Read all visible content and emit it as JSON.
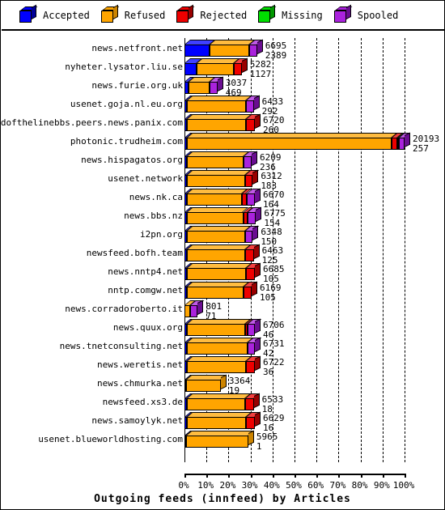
{
  "title": "Outgoing feeds (innfeed) by Articles",
  "legend": {
    "items": [
      {
        "label": "Accepted",
        "color": "#0000ff",
        "dark": "#000099",
        "icon": "cube-icon"
      },
      {
        "label": "Refused",
        "color": "#ffa500",
        "dark": "#cc8400",
        "icon": "cube-icon"
      },
      {
        "label": "Rejected",
        "color": "#ee0000",
        "dark": "#990000",
        "icon": "cube-icon"
      },
      {
        "label": "Missing",
        "color": "#00dd00",
        "dark": "#009900",
        "icon": "cube-icon"
      },
      {
        "label": "Spooled",
        "color": "#aa22dd",
        "dark": "#6a0d91",
        "icon": "cube-icon"
      }
    ]
  },
  "xaxis": {
    "ticks": [
      "0%",
      "10%",
      "20%",
      "30%",
      "40%",
      "50%",
      "60%",
      "70%",
      "80%",
      "90%",
      "100%"
    ],
    "min": 0,
    "max": 100
  },
  "chart_data": {
    "type": "bar",
    "orientation": "horizontal",
    "stacked": true,
    "percent": true,
    "title": "Outgoing feeds (innfeed) by Articles",
    "xlabel": "",
    "ylabel": "",
    "xlim": [
      0,
      100
    ],
    "grid": true,
    "legend_position": "top",
    "series": [
      {
        "name": "Accepted",
        "color": "#0000ff"
      },
      {
        "name": "Refused",
        "color": "#ffa500"
      },
      {
        "name": "Rejected",
        "color": "#ee0000"
      },
      {
        "name": "Missing",
        "color": "#00dd00"
      },
      {
        "name": "Spooled",
        "color": "#aa22dd"
      }
    ],
    "categories": [
      "news.netfront.net",
      "nyheter.lysator.liu.se",
      "news.furie.org.uk",
      "usenet.goja.nl.eu.org",
      "endofthelinebbs.peers.news.panix.com",
      "photonic.trudheim.com",
      "news.hispagatos.org",
      "usenet.network",
      "news.nk.ca",
      "news.bbs.nz",
      "i2pn.org",
      "newsfeed.bofh.team",
      "news.nntp4.net",
      "nntp.comgw.net",
      "news.corradoroberto.it",
      "news.quux.org",
      "news.tnetconsulting.net",
      "news.weretis.net",
      "news.chmurka.net",
      "newsfeed.xs3.de",
      "news.samoylyk.net",
      "usenet.blueworldhosting.com"
    ],
    "rows": [
      {
        "category": "news.netfront.net",
        "labels": [
          "6695",
          "2389"
        ],
        "total_pct": 33.0,
        "segments": [
          {
            "name": "Accepted",
            "pct": 11.5
          },
          {
            "name": "Refused",
            "pct": 18.0
          },
          {
            "name": "Spooled",
            "pct": 3.5
          }
        ]
      },
      {
        "category": "nyheter.lysator.liu.se",
        "labels": [
          "5282",
          "1127"
        ],
        "total_pct": 26.0,
        "segments": [
          {
            "name": "Accepted",
            "pct": 5.5
          },
          {
            "name": "Refused",
            "pct": 17.0
          },
          {
            "name": "Rejected",
            "pct": 3.5
          }
        ]
      },
      {
        "category": "news.furie.org.uk",
        "labels": [
          "3037",
          "469"
        ],
        "total_pct": 15.0,
        "segments": [
          {
            "name": "Accepted",
            "pct": 2.0
          },
          {
            "name": "Refused",
            "pct": 9.5
          },
          {
            "name": "Spooled",
            "pct": 3.5
          }
        ]
      },
      {
        "category": "usenet.goja.nl.eu.org",
        "labels": [
          "6433",
          "292"
        ],
        "total_pct": 31.5,
        "segments": [
          {
            "name": "Accepted",
            "pct": 1.2
          },
          {
            "name": "Refused",
            "pct": 26.8
          },
          {
            "name": "Spooled",
            "pct": 3.5
          }
        ]
      },
      {
        "category": "endofthelinebbs.peers.news.panix.com",
        "labels": [
          "6720",
          "260"
        ],
        "total_pct": 32.0,
        "segments": [
          {
            "name": "Accepted",
            "pct": 1.2
          },
          {
            "name": "Refused",
            "pct": 26.8
          },
          {
            "name": "Rejected",
            "pct": 4.0
          }
        ]
      },
      {
        "category": "photonic.trudheim.com",
        "labels": [
          "20193",
          "257"
        ],
        "total_pct": 100.0,
        "segments": [
          {
            "name": "Accepted",
            "pct": 1.2
          },
          {
            "name": "Refused",
            "pct": 93.0
          },
          {
            "name": "Rejected",
            "pct": 2.4
          },
          {
            "name": "Missing",
            "pct": 0.9
          },
          {
            "name": "Spooled",
            "pct": 2.5
          }
        ]
      },
      {
        "category": "news.hispagatos.org",
        "labels": [
          "6209",
          "236"
        ],
        "total_pct": 30.5,
        "segments": [
          {
            "name": "Accepted",
            "pct": 1.2
          },
          {
            "name": "Refused",
            "pct": 25.8
          },
          {
            "name": "Spooled",
            "pct": 3.5
          }
        ]
      },
      {
        "category": "usenet.network",
        "labels": [
          "6312",
          "183"
        ],
        "total_pct": 31.0,
        "segments": [
          {
            "name": "Accepted",
            "pct": 1.2
          },
          {
            "name": "Refused",
            "pct": 26.3
          },
          {
            "name": "Rejected",
            "pct": 3.5
          }
        ]
      },
      {
        "category": "news.nk.ca",
        "labels": [
          "6670",
          "164"
        ],
        "total_pct": 32.0,
        "segments": [
          {
            "name": "Accepted",
            "pct": 1.2
          },
          {
            "name": "Refused",
            "pct": 25.0
          },
          {
            "name": "Rejected",
            "pct": 2.0
          },
          {
            "name": "Spooled",
            "pct": 3.8
          }
        ]
      },
      {
        "category": "news.bbs.nz",
        "labels": [
          "6775",
          "154"
        ],
        "total_pct": 32.5,
        "segments": [
          {
            "name": "Accepted",
            "pct": 1.2
          },
          {
            "name": "Refused",
            "pct": 25.5
          },
          {
            "name": "Rejected",
            "pct": 2.0
          },
          {
            "name": "Spooled",
            "pct": 3.8
          }
        ]
      },
      {
        "category": "i2pn.org",
        "labels": [
          "6348",
          "150"
        ],
        "total_pct": 31.0,
        "segments": [
          {
            "name": "Accepted",
            "pct": 1.2
          },
          {
            "name": "Refused",
            "pct": 26.3
          },
          {
            "name": "Spooled",
            "pct": 3.5
          }
        ]
      },
      {
        "category": "newsfeed.bofh.team",
        "labels": [
          "6463",
          "125"
        ],
        "total_pct": 31.5,
        "segments": [
          {
            "name": "Accepted",
            "pct": 1.2
          },
          {
            "name": "Refused",
            "pct": 26.3
          },
          {
            "name": "Rejected",
            "pct": 4.0
          }
        ]
      },
      {
        "category": "news.nntp4.net",
        "labels": [
          "6685",
          "105"
        ],
        "total_pct": 32.0,
        "segments": [
          {
            "name": "Accepted",
            "pct": 1.2
          },
          {
            "name": "Refused",
            "pct": 26.8
          },
          {
            "name": "Rejected",
            "pct": 4.0
          }
        ]
      },
      {
        "category": "nntp.comgw.net",
        "labels": [
          "6169",
          "105"
        ],
        "total_pct": 30.5,
        "segments": [
          {
            "name": "Accepted",
            "pct": 1.2
          },
          {
            "name": "Refused",
            "pct": 25.8
          },
          {
            "name": "Rejected",
            "pct": 3.5
          }
        ]
      },
      {
        "category": "news.corradoroberto.it",
        "labels": [
          "801",
          "71"
        ],
        "total_pct": 6.0,
        "segments": [
          {
            "name": "Refused",
            "pct": 2.5
          },
          {
            "name": "Spooled",
            "pct": 3.5
          }
        ]
      },
      {
        "category": "news.quux.org",
        "labels": [
          "6706",
          "46"
        ],
        "total_pct": 32.0,
        "segments": [
          {
            "name": "Accepted",
            "pct": 1.0
          },
          {
            "name": "Refused",
            "pct": 26.5
          },
          {
            "name": "Rejected",
            "pct": 1.0
          },
          {
            "name": "Spooled",
            "pct": 3.5
          }
        ]
      },
      {
        "category": "news.tnetconsulting.net",
        "labels": [
          "6731",
          "42"
        ],
        "total_pct": 32.0,
        "segments": [
          {
            "name": "Accepted",
            "pct": 1.0
          },
          {
            "name": "Refused",
            "pct": 27.5
          },
          {
            "name": "Spooled",
            "pct": 3.5
          }
        ]
      },
      {
        "category": "news.weretis.net",
        "labels": [
          "6722",
          "36"
        ],
        "total_pct": 32.0,
        "segments": [
          {
            "name": "Accepted",
            "pct": 1.0
          },
          {
            "name": "Refused",
            "pct": 27.0
          },
          {
            "name": "Rejected",
            "pct": 4.0
          }
        ]
      },
      {
        "category": "news.chmurka.net",
        "labels": [
          "3364",
          "19"
        ],
        "total_pct": 16.5,
        "segments": [
          {
            "name": "Accepted",
            "pct": 0.8
          },
          {
            "name": "Refused",
            "pct": 15.7
          }
        ]
      },
      {
        "category": "newsfeed.xs3.de",
        "labels": [
          "6533",
          "18"
        ],
        "total_pct": 31.5,
        "segments": [
          {
            "name": "Accepted",
            "pct": 1.0
          },
          {
            "name": "Refused",
            "pct": 26.5
          },
          {
            "name": "Rejected",
            "pct": 4.0
          }
        ]
      },
      {
        "category": "news.samoylyk.net",
        "labels": [
          "6629",
          "16"
        ],
        "total_pct": 32.0,
        "segments": [
          {
            "name": "Accepted",
            "pct": 1.0
          },
          {
            "name": "Refused",
            "pct": 27.0
          },
          {
            "name": "Rejected",
            "pct": 4.0
          }
        ]
      },
      {
        "category": "usenet.blueworldhosting.com",
        "labels": [
          "5965",
          "1"
        ],
        "total_pct": 29.0,
        "segments": [
          {
            "name": "Accepted",
            "pct": 0.8
          },
          {
            "name": "Refused",
            "pct": 28.2
          }
        ]
      }
    ]
  }
}
